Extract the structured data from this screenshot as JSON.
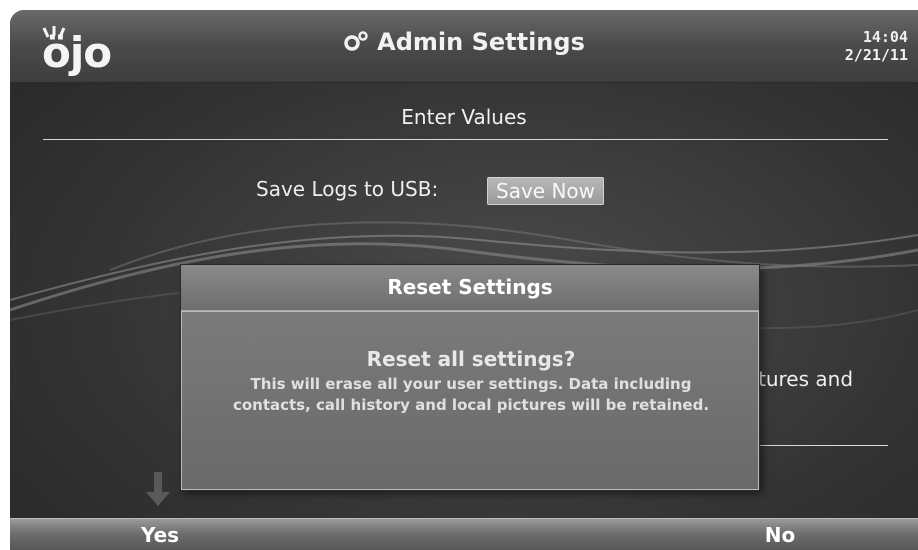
{
  "header": {
    "logo_text": "öjo",
    "title": "Admin Settings",
    "time": "14:04",
    "date": "2/21/11"
  },
  "page": {
    "subtitle": "Enter Values",
    "usb_label": "Save Logs to USB:",
    "save_now_label": "Save Now",
    "partial_text": "tures and"
  },
  "dialog": {
    "title": "Reset Settings",
    "heading": "Reset all settings?",
    "message": "This will erase all your user settings. Data including contacts, call history and local pictures will be retained."
  },
  "footer": {
    "yes_label": "Yes",
    "no_label": "No"
  },
  "icons": {
    "logo": "ojo-logo",
    "title_icon": "gear-icon",
    "scroll_hint": "arrow-down-icon"
  }
}
